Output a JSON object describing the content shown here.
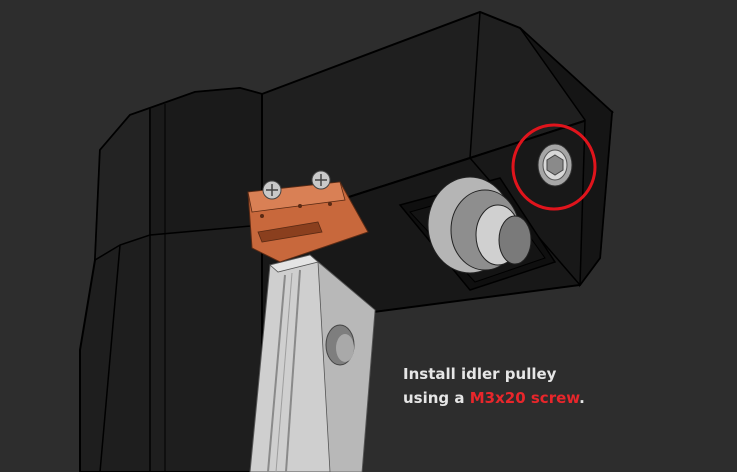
{
  "instruction": {
    "line1": "Install idler pulley",
    "line2_prefix": "using a ",
    "line2_highlight": "M3x20 screw",
    "line2_suffix": "."
  },
  "colors": {
    "background": "#2d2d2d",
    "body": "#1b1b1b",
    "edge": "#000000",
    "highlight_text": "#e8262b",
    "callout_circle": "#e0141c",
    "bracket": "#c8683c",
    "rail": "#c9c9c9"
  }
}
